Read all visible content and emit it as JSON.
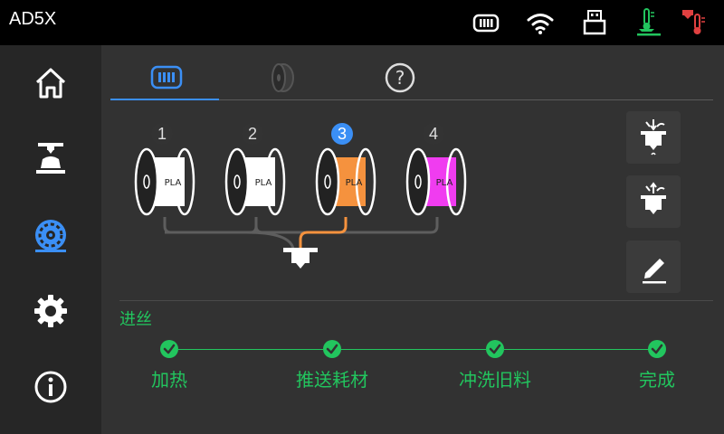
{
  "app": {
    "title": "AD5X"
  },
  "topbar_icons": [
    {
      "name": "filament-box-icon",
      "color": "#ffffff"
    },
    {
      "name": "wifi-icon",
      "color": "#ffffff"
    },
    {
      "name": "usb-icon",
      "color": "#ffffff"
    },
    {
      "name": "nozzle-temp-icon",
      "color": "#22c55e"
    },
    {
      "name": "bed-temp-icon",
      "color": "#e04040"
    }
  ],
  "sidebar": {
    "items": [
      {
        "name": "home-icon",
        "active": false
      },
      {
        "name": "print-icon",
        "active": false
      },
      {
        "name": "filament-icon",
        "active": true
      },
      {
        "name": "settings-icon",
        "active": false
      },
      {
        "name": "info-icon",
        "active": false
      }
    ]
  },
  "tabs": [
    {
      "name": "material-station-tab",
      "active": true
    },
    {
      "name": "external-spool-tab",
      "active": false
    },
    {
      "name": "help-tab",
      "active": false,
      "label": "?"
    }
  ],
  "slots": [
    {
      "number": "1",
      "material": "PLA",
      "color": "#ffffff",
      "active": false
    },
    {
      "number": "2",
      "material": "PLA",
      "color": "#ffffff",
      "active": false
    },
    {
      "number": "3",
      "material": "PLA",
      "color": "#f5923e",
      "active": true
    },
    {
      "number": "4",
      "material": "PLA",
      "color": "#f03cf0",
      "active": false
    }
  ],
  "section": {
    "title": "进丝"
  },
  "steps": [
    {
      "label": "加热",
      "done": true
    },
    {
      "label": "推送耗材",
      "done": true
    },
    {
      "label": "冲洗旧料",
      "done": true
    },
    {
      "label": "完成",
      "done": true
    }
  ],
  "colors": {
    "accent": "#3b8ff5",
    "success": "#22c55e",
    "feed_line": "#f5923e",
    "idle_line": "#5e5e5e"
  }
}
